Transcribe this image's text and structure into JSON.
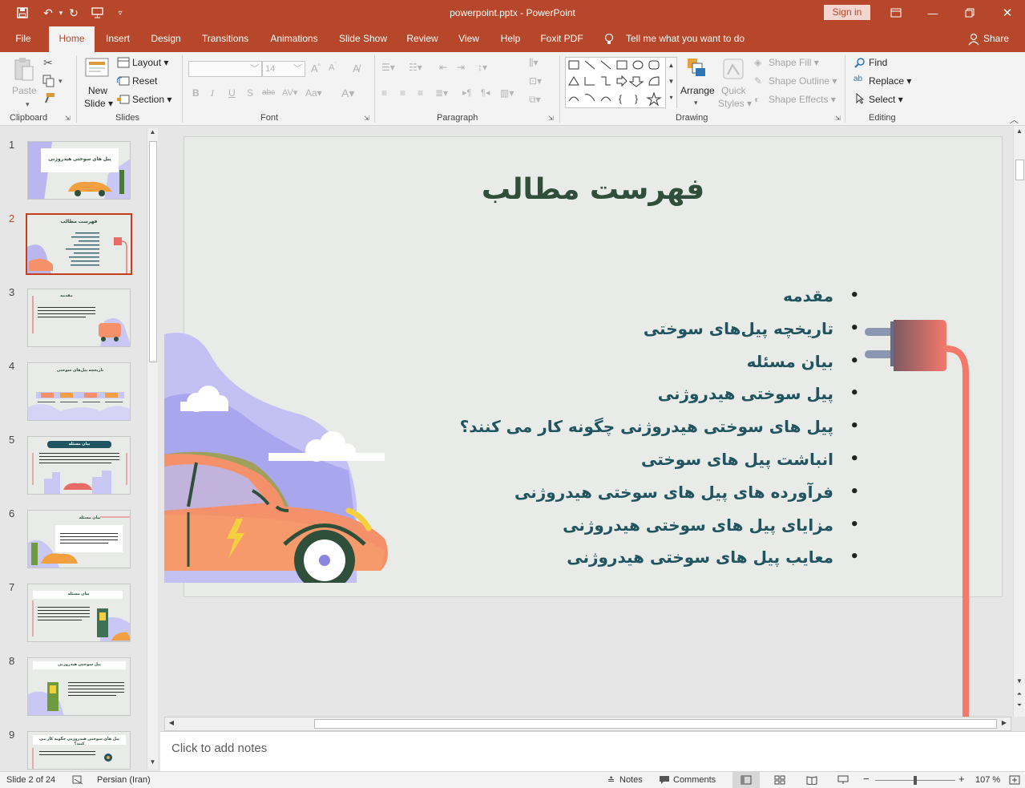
{
  "window": {
    "file_title": "powerpoint.pptx",
    "app_title": "PowerPoint",
    "separator": "-",
    "sign_in": "Sign in"
  },
  "tabs": [
    "File",
    "Home",
    "Insert",
    "Design",
    "Transitions",
    "Animations",
    "Slide Show",
    "Review",
    "View",
    "Help",
    "Foxit PDF"
  ],
  "tell_me": "Tell me what you want to do",
  "share": "Share",
  "ribbon": {
    "clipboard": {
      "label": "Clipboard",
      "paste": "Paste"
    },
    "slides": {
      "label": "Slides",
      "new": "New",
      "slide": "Slide",
      "layout": "Layout",
      "reset": "Reset",
      "section": "Section"
    },
    "font": {
      "label": "Font",
      "size": "14"
    },
    "paragraph": {
      "label": "Paragraph"
    },
    "drawing": {
      "label": "Drawing",
      "arrange": "Arrange",
      "quick": "Quick",
      "styles": "Styles",
      "shape_fill": "Shape Fill",
      "shape_outline": "Shape Outline",
      "shape_effects": "Shape Effects"
    },
    "editing": {
      "label": "Editing",
      "find": "Find",
      "replace": "Replace",
      "select": "Select"
    }
  },
  "thumbnails": [
    "1",
    "2",
    "3",
    "4",
    "5",
    "6",
    "7",
    "8",
    "9"
  ],
  "thumb_text": {
    "t1": "پیل های سوختی هیدروژنی",
    "t2": "فهرست مطالب",
    "t3": "مقدمه",
    "t4": "تاریخچه پیل‌های سوختی",
    "t5": "بیان مسئله",
    "t6": "بیان مسئله",
    "t7": "بیان مسئله",
    "t8": "پیل سوختی هیدروژنی",
    "t9": "پیل های سوختی هیدروژنی چگونه کار می کنند؟"
  },
  "slide": {
    "title": "فهرست مطالب",
    "bullets": [
      "مقدمه",
      "تاریخچه پیل‌های سوختی",
      "بیان مسئله",
      "پیل سوختی هیدروژنی",
      "پیل های سوختی هیدروژنی چگونه کار می کنند؟",
      "انباشت پیل های سوختی",
      "فرآورده های پیل های سوختی هیدروژنی",
      "مزایای پیل های سوختی هیدروژنی",
      "معایب پیل های سوختی هیدروژنی"
    ]
  },
  "notes_placeholder": "Click to add notes",
  "status": {
    "slide_of": "Slide 2 of 24",
    "language": "Persian (Iran)",
    "notes": "Notes",
    "comments": "Comments",
    "zoom": "107 %",
    "minus": "−",
    "plus": "+"
  },
  "colors": {
    "accent": "#b7472a",
    "slide_bg": "#e9ebe8",
    "title": "#2f4f3a",
    "bullet": "#1f5460",
    "plug": "#f4796b"
  }
}
